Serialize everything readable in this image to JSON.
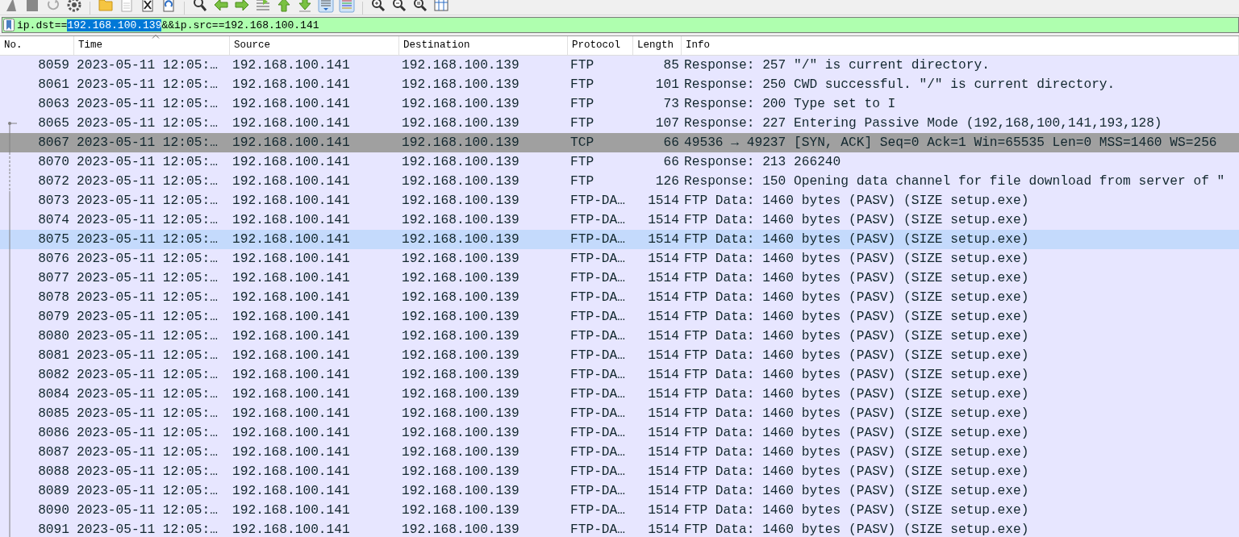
{
  "filter": {
    "segments": [
      {
        "text": "ip.dst==",
        "selected": false
      },
      {
        "text": "192.168.100.139",
        "selected": true
      },
      {
        "text": "&&ip.src==192.168.100.141",
        "selected": false
      }
    ]
  },
  "packet_list": {
    "columns": [
      {
        "label": "No.",
        "sorted": false
      },
      {
        "label": "Time",
        "sorted": true
      },
      {
        "label": "Source",
        "sorted": false
      },
      {
        "label": "Destination",
        "sorted": false
      },
      {
        "label": "Protocol",
        "sorted": false
      },
      {
        "label": "Length",
        "sorted": false
      },
      {
        "label": "Info",
        "sorted": false
      }
    ],
    "rows": [
      {
        "no": "8059",
        "time": "2023-05-11 12:05:…",
        "source": "192.168.100.141",
        "destination": "192.168.100.139",
        "protocol": "FTP",
        "length": "85",
        "info": "Response: 257 \"/\" is current directory.",
        "selected": false,
        "hovered": false,
        "kind": "plain"
      },
      {
        "no": "8061",
        "time": "2023-05-11 12:05:…",
        "source": "192.168.100.141",
        "destination": "192.168.100.139",
        "protocol": "FTP",
        "length": "101",
        "info": "Response: 250 CWD successful. \"/\" is current directory.",
        "selected": false,
        "hovered": false,
        "kind": "plain"
      },
      {
        "no": "8063",
        "time": "2023-05-11 12:05:…",
        "source": "192.168.100.141",
        "destination": "192.168.100.139",
        "protocol": "FTP",
        "length": "73",
        "info": "Response: 200 Type set to I",
        "selected": false,
        "hovered": false,
        "kind": "plain"
      },
      {
        "no": "8065",
        "time": "2023-05-11 12:05:…",
        "source": "192.168.100.141",
        "destination": "192.168.100.139",
        "protocol": "FTP",
        "length": "107",
        "info": "Response: 227 Entering Passive Mode (192,168,100,141,193,128)",
        "selected": false,
        "hovered": false,
        "kind": "start"
      },
      {
        "no": "8067",
        "time": "2023-05-11 12:05:…",
        "source": "192.168.100.141",
        "destination": "192.168.100.139",
        "protocol": "TCP",
        "length": "66",
        "info": "49536 → 49237 [SYN, ACK] Seq=0 Ack=1 Win=65535 Len=0 MSS=1460 WS=256",
        "selected": true,
        "hovered": false,
        "kind": "linked"
      },
      {
        "no": "8070",
        "time": "2023-05-11 12:05:…",
        "source": "192.168.100.141",
        "destination": "192.168.100.139",
        "protocol": "FTP",
        "length": "66",
        "info": "Response: 213 266240",
        "selected": false,
        "hovered": false,
        "kind": "dashed"
      },
      {
        "no": "8072",
        "time": "2023-05-11 12:05:…",
        "source": "192.168.100.141",
        "destination": "192.168.100.139",
        "protocol": "FTP",
        "length": "126",
        "info": "Response: 150 Opening data channel for file download from server of \"",
        "selected": false,
        "hovered": false,
        "kind": "dashed"
      },
      {
        "no": "8073",
        "time": "2023-05-11 12:05:…",
        "source": "192.168.100.141",
        "destination": "192.168.100.139",
        "protocol": "FTP-DA…",
        "length": "1514",
        "info": "FTP Data: 1460 bytes (PASV) (SIZE setup.exe)",
        "selected": false,
        "hovered": false,
        "kind": "linked"
      },
      {
        "no": "8074",
        "time": "2023-05-11 12:05:…",
        "source": "192.168.100.141",
        "destination": "192.168.100.139",
        "protocol": "FTP-DA…",
        "length": "1514",
        "info": "FTP Data: 1460 bytes (PASV) (SIZE setup.exe)",
        "selected": false,
        "hovered": false,
        "kind": "linked"
      },
      {
        "no": "8075",
        "time": "2023-05-11 12:05:…",
        "source": "192.168.100.141",
        "destination": "192.168.100.139",
        "protocol": "FTP-DA…",
        "length": "1514",
        "info": "FTP Data: 1460 bytes (PASV) (SIZE setup.exe)",
        "selected": false,
        "hovered": true,
        "kind": "linked"
      },
      {
        "no": "8076",
        "time": "2023-05-11 12:05:…",
        "source": "192.168.100.141",
        "destination": "192.168.100.139",
        "protocol": "FTP-DA…",
        "length": "1514",
        "info": "FTP Data: 1460 bytes (PASV) (SIZE setup.exe)",
        "selected": false,
        "hovered": false,
        "kind": "linked"
      },
      {
        "no": "8077",
        "time": "2023-05-11 12:05:…",
        "source": "192.168.100.141",
        "destination": "192.168.100.139",
        "protocol": "FTP-DA…",
        "length": "1514",
        "info": "FTP Data: 1460 bytes (PASV) (SIZE setup.exe)",
        "selected": false,
        "hovered": false,
        "kind": "linked"
      },
      {
        "no": "8078",
        "time": "2023-05-11 12:05:…",
        "source": "192.168.100.141",
        "destination": "192.168.100.139",
        "protocol": "FTP-DA…",
        "length": "1514",
        "info": "FTP Data: 1460 bytes (PASV) (SIZE setup.exe)",
        "selected": false,
        "hovered": false,
        "kind": "linked"
      },
      {
        "no": "8079",
        "time": "2023-05-11 12:05:…",
        "source": "192.168.100.141",
        "destination": "192.168.100.139",
        "protocol": "FTP-DA…",
        "length": "1514",
        "info": "FTP Data: 1460 bytes (PASV) (SIZE setup.exe)",
        "selected": false,
        "hovered": false,
        "kind": "linked"
      },
      {
        "no": "8080",
        "time": "2023-05-11 12:05:…",
        "source": "192.168.100.141",
        "destination": "192.168.100.139",
        "protocol": "FTP-DA…",
        "length": "1514",
        "info": "FTP Data: 1460 bytes (PASV) (SIZE setup.exe)",
        "selected": false,
        "hovered": false,
        "kind": "linked"
      },
      {
        "no": "8081",
        "time": "2023-05-11 12:05:…",
        "source": "192.168.100.141",
        "destination": "192.168.100.139",
        "protocol": "FTP-DA…",
        "length": "1514",
        "info": "FTP Data: 1460 bytes (PASV) (SIZE setup.exe)",
        "selected": false,
        "hovered": false,
        "kind": "linked"
      },
      {
        "no": "8082",
        "time": "2023-05-11 12:05:…",
        "source": "192.168.100.141",
        "destination": "192.168.100.139",
        "protocol": "FTP-DA…",
        "length": "1514",
        "info": "FTP Data: 1460 bytes (PASV) (SIZE setup.exe)",
        "selected": false,
        "hovered": false,
        "kind": "linked"
      },
      {
        "no": "8084",
        "time": "2023-05-11 12:05:…",
        "source": "192.168.100.141",
        "destination": "192.168.100.139",
        "protocol": "FTP-DA…",
        "length": "1514",
        "info": "FTP Data: 1460 bytes (PASV) (SIZE setup.exe)",
        "selected": false,
        "hovered": false,
        "kind": "linked"
      },
      {
        "no": "8085",
        "time": "2023-05-11 12:05:…",
        "source": "192.168.100.141",
        "destination": "192.168.100.139",
        "protocol": "FTP-DA…",
        "length": "1514",
        "info": "FTP Data: 1460 bytes (PASV) (SIZE setup.exe)",
        "selected": false,
        "hovered": false,
        "kind": "linked"
      },
      {
        "no": "8086",
        "time": "2023-05-11 12:05:…",
        "source": "192.168.100.141",
        "destination": "192.168.100.139",
        "protocol": "FTP-DA…",
        "length": "1514",
        "info": "FTP Data: 1460 bytes (PASV) (SIZE setup.exe)",
        "selected": false,
        "hovered": false,
        "kind": "linked"
      },
      {
        "no": "8087",
        "time": "2023-05-11 12:05:…",
        "source": "192.168.100.141",
        "destination": "192.168.100.139",
        "protocol": "FTP-DA…",
        "length": "1514",
        "info": "FTP Data: 1460 bytes (PASV) (SIZE setup.exe)",
        "selected": false,
        "hovered": false,
        "kind": "linked"
      },
      {
        "no": "8088",
        "time": "2023-05-11 12:05:…",
        "source": "192.168.100.141",
        "destination": "192.168.100.139",
        "protocol": "FTP-DA…",
        "length": "1514",
        "info": "FTP Data: 1460 bytes (PASV) (SIZE setup.exe)",
        "selected": false,
        "hovered": false,
        "kind": "linked"
      },
      {
        "no": "8089",
        "time": "2023-05-11 12:05:…",
        "source": "192.168.100.141",
        "destination": "192.168.100.139",
        "protocol": "FTP-DA…",
        "length": "1514",
        "info": "FTP Data: 1460 bytes (PASV) (SIZE setup.exe)",
        "selected": false,
        "hovered": false,
        "kind": "linked"
      },
      {
        "no": "8090",
        "time": "2023-05-11 12:05:…",
        "source": "192.168.100.141",
        "destination": "192.168.100.139",
        "protocol": "FTP-DA…",
        "length": "1514",
        "info": "FTP Data: 1460 bytes (PASV) (SIZE setup.exe)",
        "selected": false,
        "hovered": false,
        "kind": "linked"
      },
      {
        "no": "8091",
        "time": "2023-05-11 12:05:…",
        "source": "192.168.100.141",
        "destination": "192.168.100.139",
        "protocol": "FTP-DA…",
        "length": "1514",
        "info": "FTP Data: 1460 bytes (PASV) (SIZE setup.exe)",
        "selected": false,
        "hovered": false,
        "kind": "linked"
      }
    ]
  }
}
